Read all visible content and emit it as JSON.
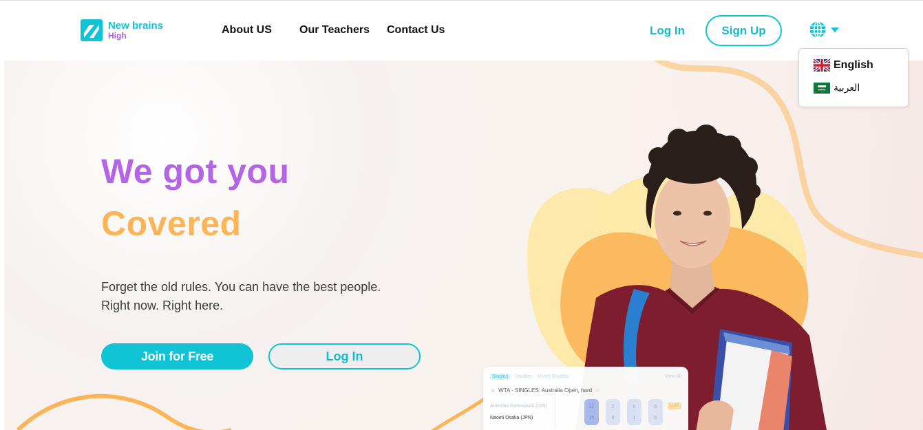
{
  "brand": {
    "name": "New brains",
    "sub": "High"
  },
  "nav": {
    "items": [
      {
        "label": "About US"
      },
      {
        "label": "Our Teachers"
      },
      {
        "label": "Contact Us"
      }
    ],
    "login_label": "Log In",
    "signup_label": "Sign Up",
    "language_icon": "globe-icon"
  },
  "language_menu": {
    "options": [
      {
        "label": "English",
        "flag": "uk-flag-icon"
      },
      {
        "label": "العربية",
        "flag": "saudi-flag-icon"
      }
    ]
  },
  "hero": {
    "headline_line1": "We got you",
    "headline_line2": "Covered",
    "tagline_line1": "Forget the old rules. You can have the best people.",
    "tagline_line2": "Right now. Right here.",
    "primary_button": "Join for Free",
    "secondary_button": "Log In"
  },
  "score_card": {
    "tabs": [
      "Singles",
      "Doubles",
      "Mixed Doubles"
    ],
    "view_all": "View All",
    "title": "WTA - SINGLES: Australia Open, hard",
    "players": [
      "Amindita Rahmawati (IDN)",
      "Naomi Osaka (JPN)"
    ],
    "scores": [
      [
        "32",
        "15"
      ],
      [
        "2",
        "0"
      ],
      [
        "6",
        "1"
      ],
      [
        "6",
        "6"
      ]
    ],
    "badge": "LIVE"
  },
  "colors": {
    "accent": "#10c4d6",
    "purple": "#b464e6",
    "orange": "#fbb556"
  }
}
